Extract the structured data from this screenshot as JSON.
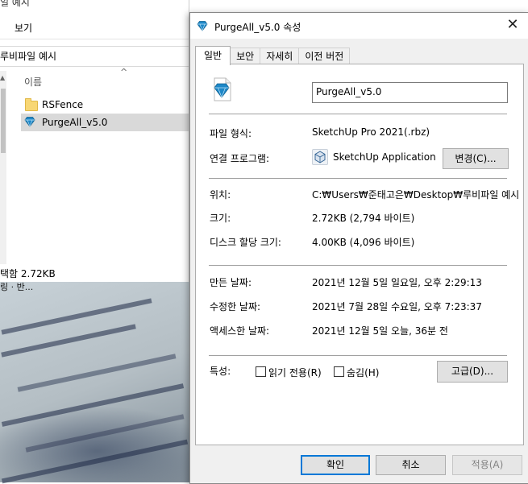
{
  "explorer": {
    "title_fragment": "일 예시",
    "menu_view": "보기",
    "address_fragment": "루비파일 예시",
    "column_name": "이름",
    "files": [
      {
        "name": "RSFence",
        "icon": "folder-icon"
      },
      {
        "name": "PurgeAll_v5.0",
        "icon": "sketchup-gem-icon"
      }
    ],
    "status": "택함 2.72KB"
  },
  "background": {
    "photo_text": "링 · 반..."
  },
  "dialog": {
    "title": "PurgeAll_v5.0 속성",
    "close_glyph": "✕",
    "tabs": [
      "일반",
      "보안",
      "자세히",
      "이전 버전"
    ],
    "file_name": "PurgeAll_v5.0",
    "rows": {
      "file_type_label": "파일 형식:",
      "file_type_value": "SketchUp Pro 2021(.rbz)",
      "opens_with_label": "연결 프로그램:",
      "opens_with_value": "SketchUp Application",
      "change_button": "변경(C)...",
      "location_label": "위치:",
      "location_value": "C:₩Users₩준태고은₩Desktop₩루비파일 예시",
      "size_label": "크기:",
      "size_value": "2.72KB (2,794 바이트)",
      "disk_size_label": "디스크 할당 크기:",
      "disk_size_value": "4.00KB (4,096 바이트)",
      "created_label": "만든 날짜:",
      "created_value": "2021년 12월 5일 일요일, 오후 2:29:13",
      "modified_label": "수정한 날짜:",
      "modified_value": "2021년 7월 28일 수요일, 오후 7:23:37",
      "accessed_label": "액세스한 날짜:",
      "accessed_value": "2021년 12월 5일 오늘, 36분 전",
      "attributes_label": "특성:",
      "readonly_label": "읽기 전용(R)",
      "hidden_label": "숨김(H)",
      "advanced_button": "고급(D)..."
    },
    "buttons": {
      "ok": "확인",
      "cancel": "취소",
      "apply": "적용(A)"
    }
  },
  "colors": {
    "accent": "#0078d7",
    "gem_blue": "#1e88c8",
    "selection": "#d9d9d9"
  }
}
